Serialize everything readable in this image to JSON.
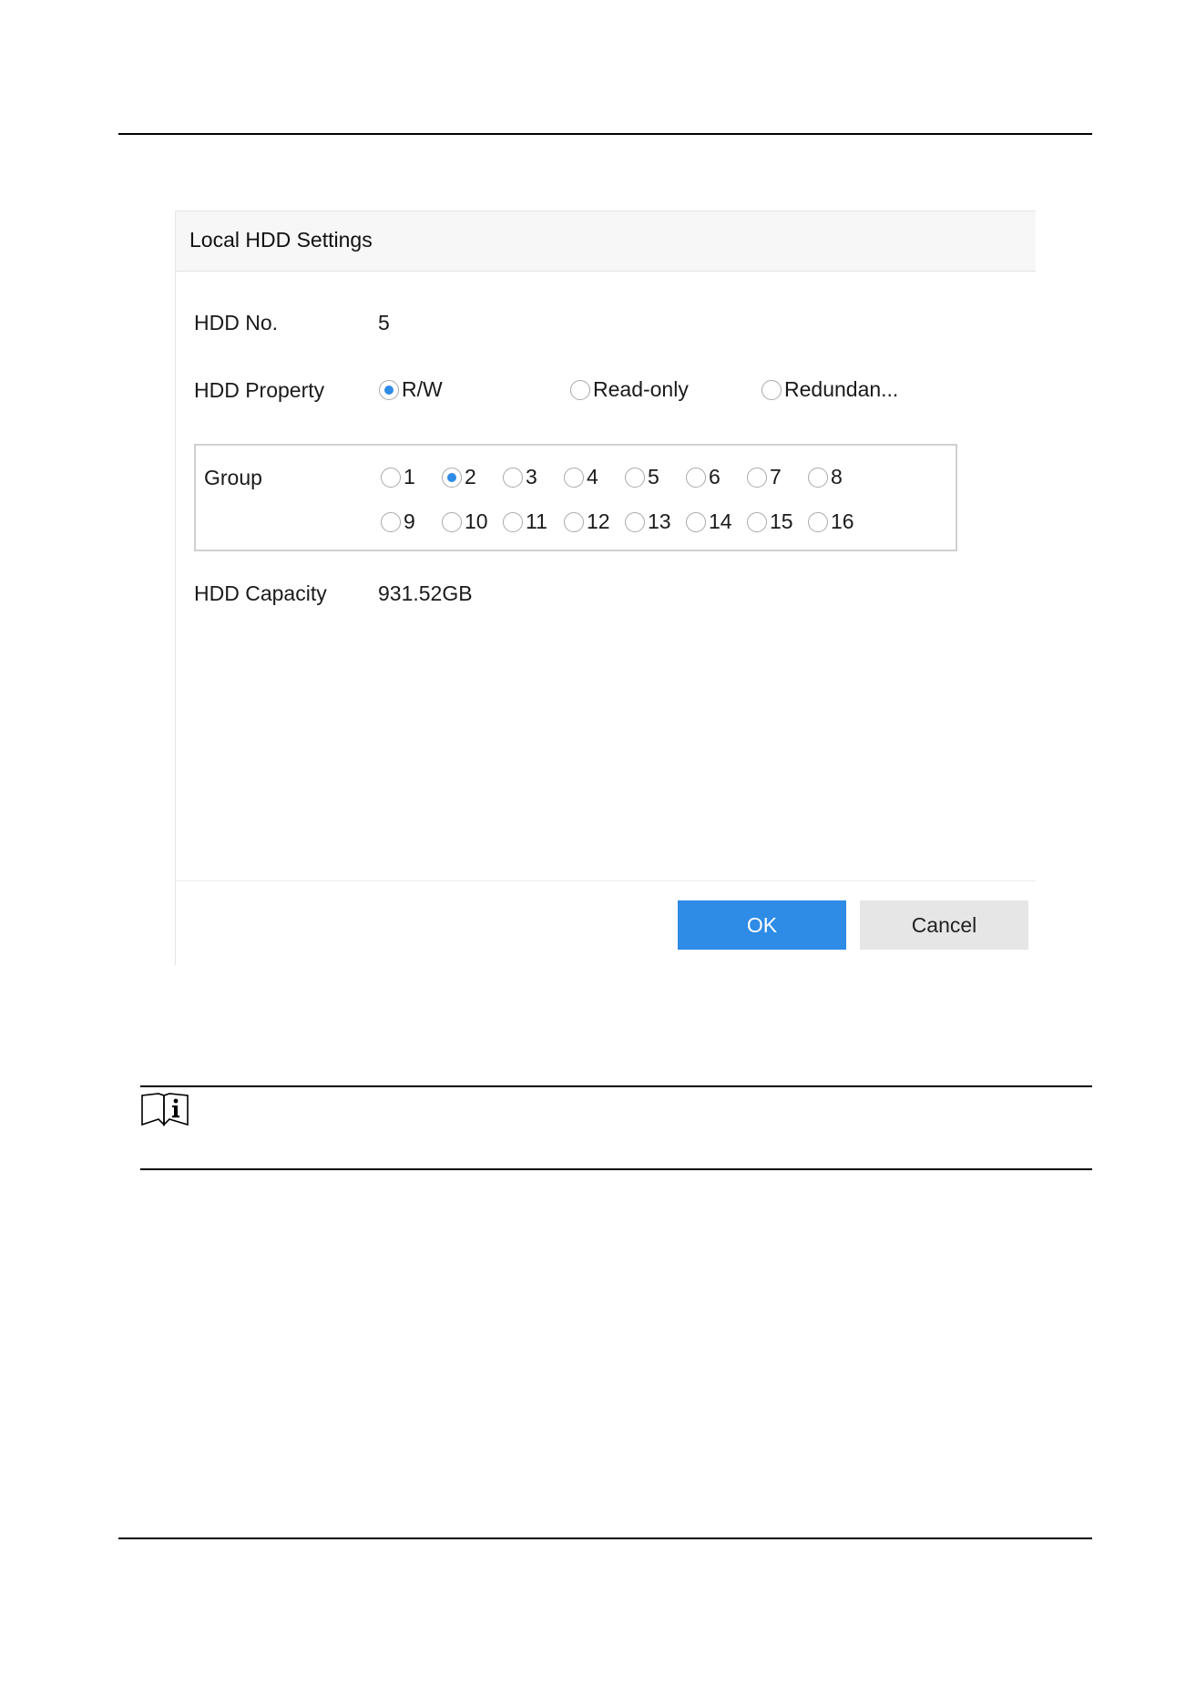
{
  "dialog": {
    "title": "Local HDD Settings",
    "hdd_no": {
      "label": "HDD No.",
      "value": "5"
    },
    "hdd_property": {
      "label": "HDD Property",
      "options": [
        "R/W",
        "Read-only",
        "Redundan..."
      ],
      "selected": "R/W"
    },
    "group": {
      "label": "Group",
      "options": [
        "1",
        "2",
        "3",
        "4",
        "5",
        "6",
        "7",
        "8",
        "9",
        "10",
        "11",
        "12",
        "13",
        "14",
        "15",
        "16"
      ],
      "selected": "2"
    },
    "hdd_capacity": {
      "label": "HDD Capacity",
      "value": "931.52GB"
    },
    "buttons": {
      "ok": "OK",
      "cancel": "Cancel"
    }
  },
  "note": {
    "icon": "note-book-info-icon"
  },
  "colors": {
    "accent": "#2e8be6",
    "cancel_bg": "#e6e6e6",
    "header_bg": "#f7f7f7"
  }
}
